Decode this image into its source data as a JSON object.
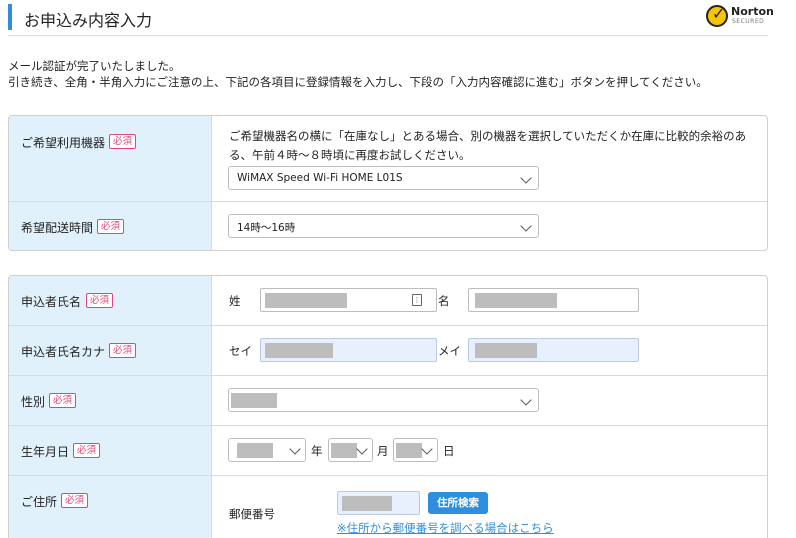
{
  "header": {
    "title": "お申込み内容入力",
    "badge_name": "Norton",
    "badge_sub": "SECURED"
  },
  "intro": {
    "line1": "メール認証が完了いたしました。",
    "line2": "引き続き、全角・半角入力にご注意の上、下記の各項目に登録情報を入力し、下段の「入力内容確認に進む」ボタンを押してください。"
  },
  "required_label": "必須",
  "device": {
    "label": "ご希望利用機器",
    "note": "ご希望機器名の横に「在庫なし」とある場合、別の機器を選択していただくか在庫に比較的余裕のある、午前４時〜８時頃に再度お試しください。",
    "selected": "WiMAX Speed Wi-Fi HOME L01S"
  },
  "delivery": {
    "label": "希望配送時間",
    "selected": "14時〜16時"
  },
  "name": {
    "label": "申込者氏名",
    "last": "姓",
    "first": "名"
  },
  "kana": {
    "label": "申込者氏名カナ",
    "last": "セイ",
    "first": "メイ"
  },
  "gender": {
    "label": "性別"
  },
  "birth": {
    "label": "生年月日",
    "year": "年",
    "month": "月",
    "day": "日"
  },
  "address": {
    "label": "ご住所",
    "postal_label": "郵便番号",
    "search_button": "住所検索",
    "lookup_link": "※住所から郵便番号を調べる場合はこちら"
  },
  "colors": {
    "accent": "#2f8fde",
    "label_bg": "#e1f1fb",
    "required": "#e0457a",
    "autofill_bg": "#e8f0fd"
  }
}
